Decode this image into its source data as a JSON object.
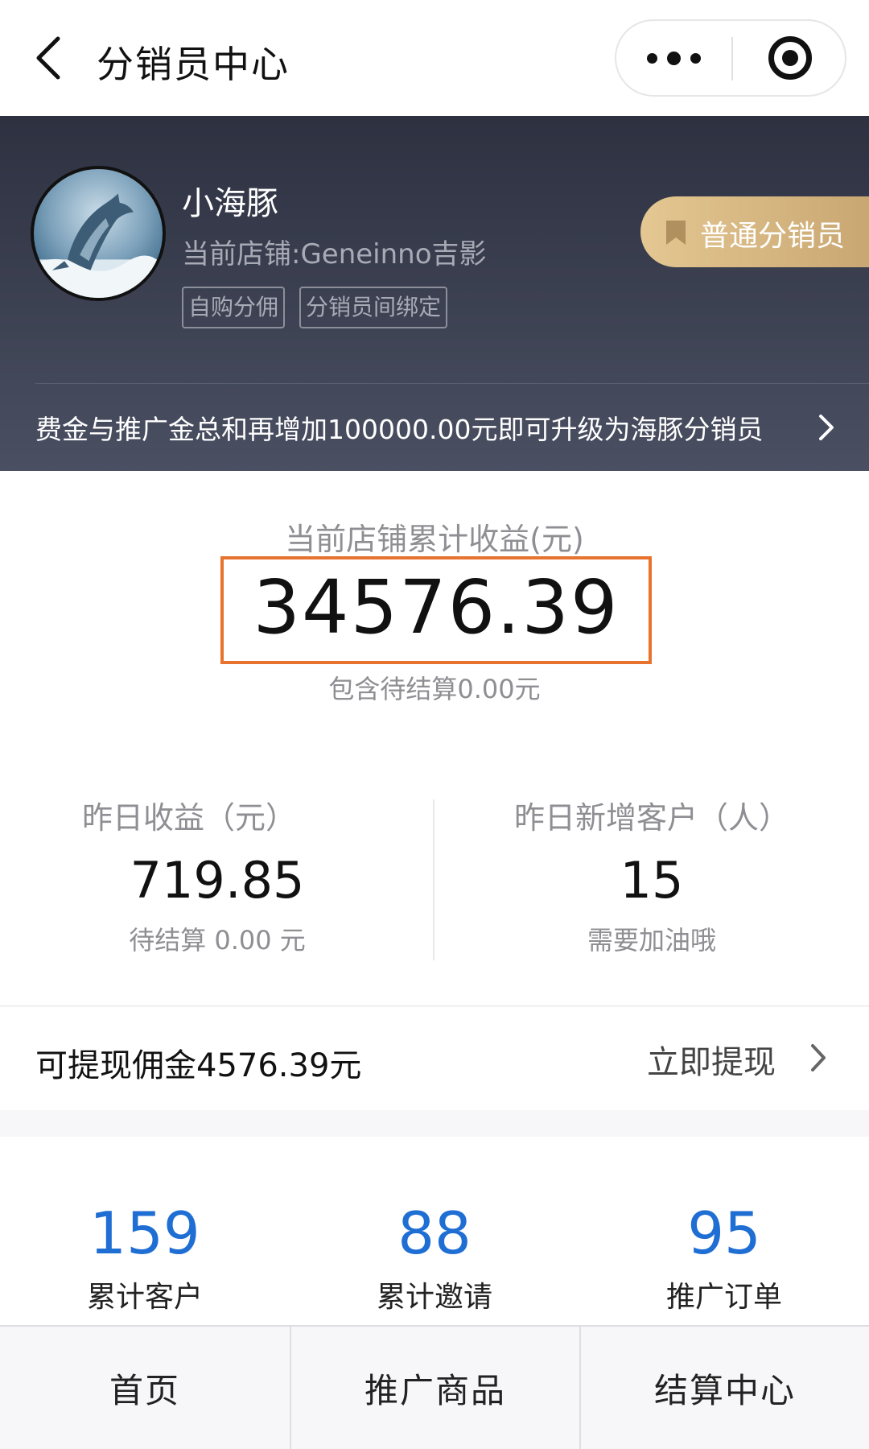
{
  "nav": {
    "title": "分销员中心"
  },
  "profile": {
    "name": "小海豚",
    "store": "当前店铺:Geneinno吉影",
    "tags": [
      "自购分佣",
      "分销员间绑定"
    ],
    "level": "普通分销员",
    "upgrade_tip": "费金与推广金总和再增加100000.00元即可升级为海豚分销员"
  },
  "earnings": {
    "title": "当前店铺累计收益(元)",
    "total": "34576.39",
    "pending": "包含待结算0.00元",
    "highlight_color": "#e8732e"
  },
  "stats": {
    "yesterday_income": {
      "label": "昨日收益（元）",
      "value": "719.85",
      "note": "待结算 0.00 元"
    },
    "yesterday_customers": {
      "label": "昨日新增客户（人）",
      "value": "15",
      "note": "需要加油哦"
    }
  },
  "withdraw": {
    "text": "可提现佣金4576.39元",
    "action": "立即提现"
  },
  "counts": [
    {
      "value": "159",
      "label": "累计客户"
    },
    {
      "value": "88",
      "label": "累计邀请"
    },
    {
      "value": "95",
      "label": "推广订单"
    }
  ],
  "count_color": "#1f6ed4",
  "tabs": [
    {
      "label": "首页"
    },
    {
      "label": "推广商品"
    },
    {
      "label": "结算中心"
    }
  ]
}
